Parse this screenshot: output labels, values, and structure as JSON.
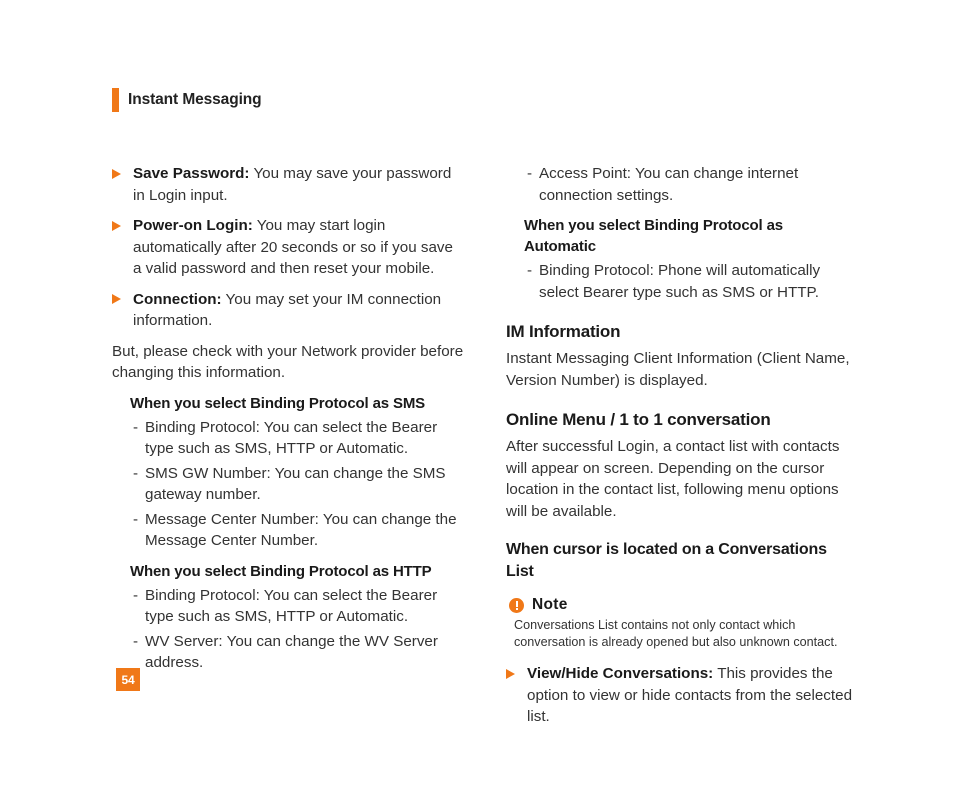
{
  "header": {
    "title": "Instant Messaging",
    "accent_color": "#F07818"
  },
  "footer": {
    "page_number": "54"
  },
  "left_column": {
    "bullets": [
      {
        "lead": "Save Password:",
        "text": " You may save your password in Login input."
      },
      {
        "lead": "Power-on Login:",
        "text": " You may start login automatically after 20 seconds or so if you save a valid password and then reset your mobile."
      },
      {
        "lead": "Connection:",
        "text": " You may set your IM connection information."
      }
    ],
    "paragraph": "But, please check with your Network provider before changing this information.",
    "sms_heading": "When you select Binding Protocol as SMS",
    "sms_items": [
      "Binding Protocol: You can select the Bearer type such as SMS, HTTP or Automatic.",
      "SMS GW Number: You can change the SMS gateway number.",
      "Message Center Number: You can change the Message Center Number."
    ],
    "http_heading": "When you select Binding Protocol as HTTP",
    "http_items": [
      "Binding Protocol: You can select the Bearer type such as SMS, HTTP or Automatic.",
      "WV Server: You can change the WV Server address."
    ]
  },
  "right_column": {
    "http_items_continued": [
      "Access Point: You can change internet connection settings."
    ],
    "automatic_heading": "When you select Binding Protocol as Automatic",
    "automatic_items": [
      "Binding Protocol: Phone will automatically select Bearer type such as SMS or HTTP."
    ],
    "im_information_heading": "IM Information",
    "im_information_body": "Instant Messaging Client Information (Client Name, Version Number) is displayed.",
    "online_menu_heading": "Online Menu / 1 to 1 conversation",
    "online_menu_body": "After successful Login, a contact list with contacts will appear on screen. Depending on the cursor location in the contact list, following menu options will be available.",
    "cursor_heading": "When cursor is located on a Conversations List",
    "note": {
      "title": "Note",
      "body": "Conversations List contains not only contact which conversation is already opened but also unknown contact."
    },
    "bullets": [
      {
        "lead": "View/Hide Conversations:",
        "text": " This provides the option to view or hide contacts from the selected list."
      }
    ]
  },
  "icons": {
    "bullet": "triangle-right-icon",
    "dash": "-",
    "note": "exclamation-circle-icon"
  }
}
